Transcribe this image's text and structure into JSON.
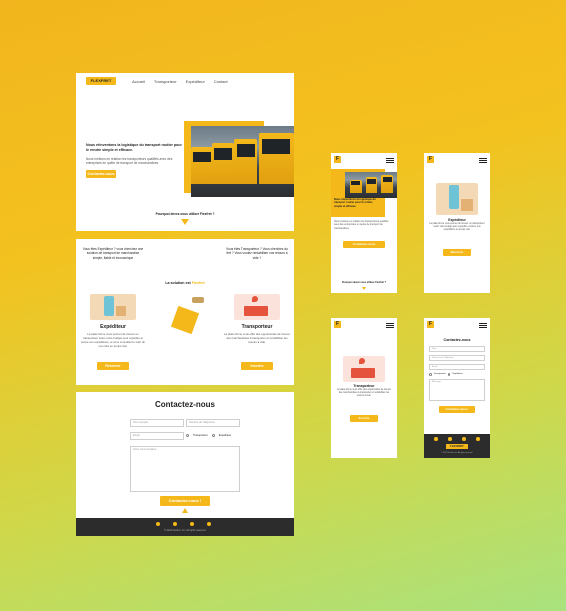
{
  "brand": {
    "logo_text": "FLEXFRET",
    "mini_logo": "F"
  },
  "nav": {
    "items": [
      "Accueil",
      "Transporteur",
      "Expéditeur",
      "Contact"
    ]
  },
  "hero": {
    "title": "Nous réinventons la logistique du transport routier pour le rendre simple et efficace.",
    "subtitle": "Nous mettons en relation les transporteurs qualifiés avec des entreprises en quête de transport de marchandises.",
    "cta": "Contactez-nous",
    "why": "Pourquoi devez-vous utiliser Flexfret ?"
  },
  "solution": {
    "shipper_question": "Vous êtes Expéditeur ? vous cherchez une solution de transport de marchandise simple, fiable et économique",
    "carrier_question": "Vous êtes Transporteur ? Vous cherchez du fret ? Vous voulez rentabiliser vos retours à vide ?",
    "center_title_prefix": "La solution est",
    "center_title_brand": "Flexfret",
    "shipper_title": "Expéditeur",
    "shipper_text": "La plate-forme vous permet de trouver un transporteur selon votre budget pour expédier et suivre vos expéditions, et vous consultez le suivi de vos colis en temps réel.",
    "shipper_btn": "Réserver",
    "carrier_title": "Transporteur",
    "carrier_text": "La plate-forme vous offre des opportunités de trouver des marchandises à transporter et rentabiliser les retours à vide.",
    "carrier_btn": "Inscrire"
  },
  "contact": {
    "title": "Contactez-nous",
    "name_placeholder": "Nom complet",
    "phone_placeholder": "Numéro de Téléphone",
    "email_placeholder": "Email",
    "radio_carrier": "Transporteur",
    "radio_shipper": "Expéditeur",
    "message_placeholder": "Votre commentaires...",
    "submit": "Contactez-nous !"
  },
  "footer": {
    "copyright": "© 2022 Flexfret, Inc. All rights reserved.",
    "socials": [
      "facebook-icon",
      "instagram-icon",
      "twitter-icon",
      "linkedin-icon"
    ]
  },
  "mobile": {
    "hero_title": "Nous réinventons la logistique du transport routier pour le rendre simple et efficace.",
    "hero_sub": "Nous mettons en relation les transporteurs qualifiés avec des entreprises en quête de transport de marchandises.",
    "hero_cta": "Contactez-nous",
    "why": "Pourquoi devez-vous utiliser Flexfret ?",
    "shipper_title": "Expéditeur",
    "shipper_text": "La plate-forme vous permet de trouver un transporteur selon votre budget pour expédier et suivre vos expéditions en temps réel.",
    "shipper_btn": "Réserver",
    "carrier_title": "Transporteur",
    "carrier_text": "La plate-forme vous offre des opportunités de trouver des marchandises à transporter et rentabiliser les retours à vide.",
    "carrier_btn": "Inscrire",
    "contact_title": "Contactez-nous",
    "nom": "Nom",
    "phone": "Numéro de Téléphone",
    "email": "Email",
    "radio_carrier": "Transporteur",
    "radio_shipper": "Expéditeur",
    "message": "Message",
    "submit": "Contactez-nous !",
    "copyright": "© 2022 Flexfret, Inc. All rights reserved."
  },
  "colors": {
    "accent": "#f4b81a",
    "dark": "#2c2c2c"
  }
}
